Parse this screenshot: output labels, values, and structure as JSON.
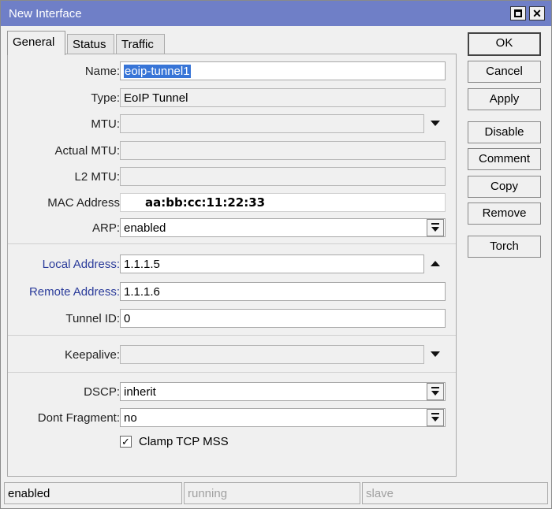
{
  "window": {
    "title": "New Interface"
  },
  "tabs": [
    {
      "label": "General"
    },
    {
      "label": "Status"
    },
    {
      "label": "Traffic"
    }
  ],
  "fields": {
    "name": {
      "label": "Name:",
      "value": "eoip-tunnel1"
    },
    "type": {
      "label": "Type:",
      "value": "EoIP Tunnel"
    },
    "mtu": {
      "label": "MTU:",
      "value": ""
    },
    "actual_mtu": {
      "label": "Actual MTU:",
      "value": ""
    },
    "l2_mtu": {
      "label": "L2 MTU:",
      "value": ""
    },
    "mac_address": {
      "label": "MAC Address",
      "value": "aa:bb:cc:11:22:33"
    },
    "arp": {
      "label": "ARP:",
      "value": "enabled"
    },
    "local_address": {
      "label": "Local Address:",
      "value": "1.1.1.5"
    },
    "remote_address": {
      "label": "Remote Address:",
      "value": "1.1.1.6"
    },
    "tunnel_id": {
      "label": "Tunnel ID:",
      "value": "0"
    },
    "keepalive": {
      "label": "Keepalive:",
      "value": ""
    },
    "dscp": {
      "label": "DSCP:",
      "value": "inherit"
    },
    "dont_fragment": {
      "label": "Dont Fragment:",
      "value": "no"
    }
  },
  "clamp_tcp_mss": {
    "label": "Clamp TCP MSS",
    "checked": true
  },
  "buttons": {
    "ok": "OK",
    "cancel": "Cancel",
    "apply": "Apply",
    "disable": "Disable",
    "comment": "Comment",
    "copy": "Copy",
    "remove": "Remove",
    "torch": "Torch"
  },
  "status": {
    "state": "enabled",
    "running": "running",
    "slave": "slave"
  },
  "colors": {
    "titlebar": "#6f7fc7",
    "label_accent": "#2a3b9a",
    "selection": "#3875d7"
  }
}
